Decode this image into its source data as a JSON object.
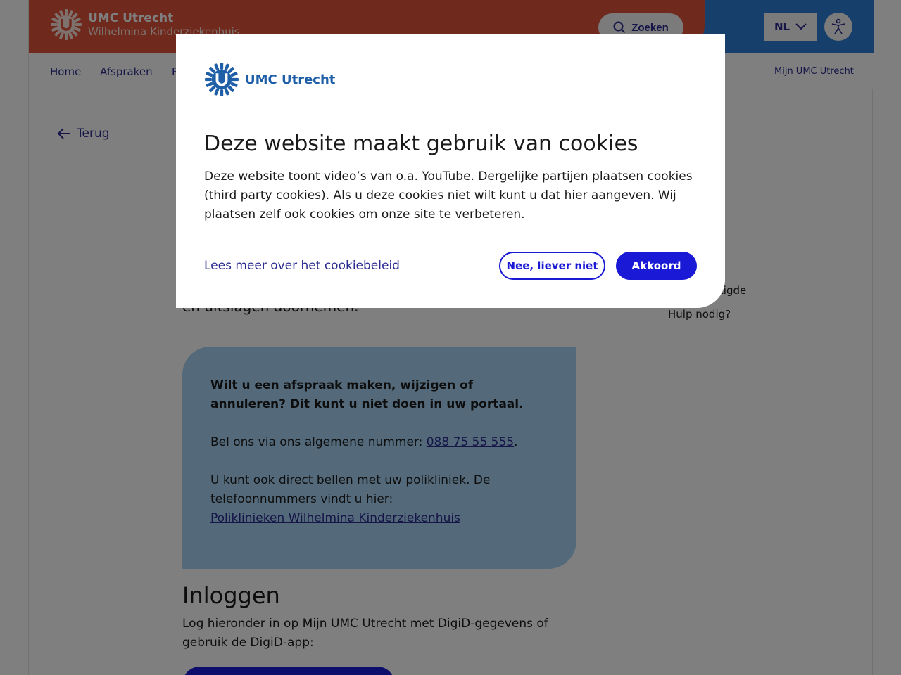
{
  "header": {
    "brand": "UMC Utrecht",
    "sub_brand": "Wilhelmina Kinderziekenhuis",
    "search_label": "Zoeken",
    "language": "NL",
    "colors": {
      "red": "#e0543a",
      "blue": "#2c7fd6"
    }
  },
  "nav": {
    "items": [
      {
        "label": "Home"
      },
      {
        "label": "Afspraken"
      },
      {
        "label": "P"
      }
    ],
    "mijn_label": "Mijn UMC Utrecht"
  },
  "back_label": "Terug",
  "intro_tail": "en uitslagen doornemen.",
  "side_links": [
    "s gemachtigde",
    "Hulp nodig?"
  ],
  "info_box": {
    "heading": "Wilt u een afspraak maken, wijzigen of annuleren? Dit kunt u niet doen in uw portaal.",
    "call_prefix": "Bel ons via ons algemene nummer: ",
    "phone": "088 75 55 555",
    "call_suffix": ".",
    "direct_text": "U kunt ook direct bellen met uw polikliniek. De telefoonnummers vindt u hier:",
    "poli_link": "Poliklinieken Wilhelmina Kinderziekenhuis"
  },
  "login": {
    "title": "Inloggen",
    "text": "Log hieronder in op Mijn UMC Utrecht met DigiD-gegevens of gebruik de DigiD-app:"
  },
  "cookie_modal": {
    "brand": "UMC Utrecht",
    "title": "Deze website maakt gebruik van cookies",
    "text": "Deze website toont video’s van o.a. YouTube. Dergelijke partijen plaatsen cookies (third party cookies). Als u deze cookies niet wilt kunt u dat hier aangeven. Wij plaatsen zelf ook cookies om onze site te verbeteren.",
    "policy_link": "Lees meer over het cookiebeleid",
    "decline_label": "Nee, liever niet",
    "accept_label": "Akkoord"
  }
}
